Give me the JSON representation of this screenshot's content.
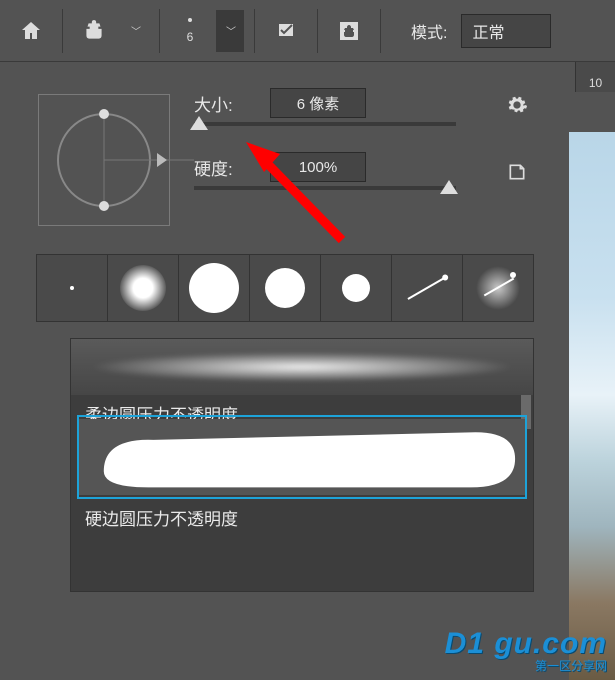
{
  "toolbar": {
    "brush_number": "6",
    "mode_label": "模式:",
    "mode_value": "正常"
  },
  "panel": {
    "size_label": "大小:",
    "size_value": "6 像素",
    "hardness_label": "硬度:",
    "hardness_value": "100%"
  },
  "strokes": {
    "item1_label": "柔边圆压力不透明度",
    "item2_label": "硬边圆压力不透明度"
  },
  "ruler": {
    "tick": "10"
  },
  "watermark": {
    "main": "D1 gu.com",
    "sub": "第一区分享网"
  }
}
